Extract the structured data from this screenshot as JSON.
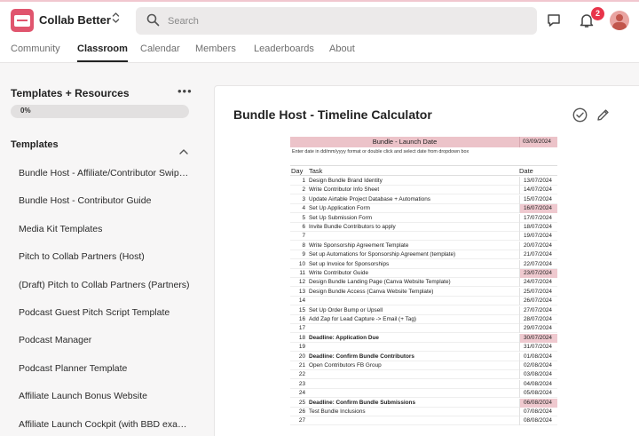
{
  "app": {
    "name": "Collab Better"
  },
  "search": {
    "placeholder": "Search"
  },
  "notifications": {
    "count": "2"
  },
  "nav": {
    "tabs": [
      "Community",
      "Classroom",
      "Calendar",
      "Members",
      "Leaderboards",
      "About"
    ],
    "active": "Classroom"
  },
  "sidebar": {
    "course_title": "Templates + Resources",
    "progress_label": "0%",
    "progress_value": 0,
    "section_title": "Templates",
    "lessons": [
      "Bundle Host - Affiliate/Contributor Swipe Copy",
      "Bundle Host - Contributor Guide",
      "Media Kit Templates",
      "Pitch to Collab Partners (Host)",
      "(Draft) Pitch to Collab Partners (Partners)",
      "Podcast Guest Pitch Script Template",
      "Podcast Manager",
      "Podcast Planner Template",
      "Affiliate Launch Bonus Website",
      "Affiliate Launch Cockpit (with BBD example)"
    ]
  },
  "main": {
    "title": "Bundle Host - Timeline Calculator"
  },
  "sheet": {
    "header": "Bundle - Launch Date",
    "header_date": "03/09/2024",
    "instructions": "Enter date in dd/mm/yyyy format or double click and select date from dropdown box",
    "col_day": "Day",
    "col_task": "Task",
    "col_date": "Date",
    "rows": [
      {
        "day": "1",
        "task": "Design Bundle Brand Identity",
        "date": "13/07/2024"
      },
      {
        "day": "2",
        "task": "Write Contributor Info Sheet",
        "date": "14/07/2024"
      },
      {
        "day": "3",
        "task": "Update Airtable Project Database + Automations",
        "date": "15/07/2024"
      },
      {
        "day": "4",
        "task": "Set Up Application Form",
        "date": "16/07/2024",
        "highlight": true
      },
      {
        "day": "5",
        "task": "Set Up Submission Form",
        "date": "17/07/2024"
      },
      {
        "day": "6",
        "task": "Invite Bundle Contributors to apply",
        "date": "18/07/2024"
      },
      {
        "day": "7",
        "task": "",
        "date": "19/07/2024"
      },
      {
        "day": "8",
        "task": "Write Sponsorship Agreement Template",
        "date": "20/07/2024"
      },
      {
        "day": "9",
        "task": "Set up Automations for Sponsorship Agreement (template)",
        "date": "21/07/2024"
      },
      {
        "day": "10",
        "task": "Set up Invoice for Sponsorships",
        "date": "22/07/2024"
      },
      {
        "day": "11",
        "task": "Write Contributor Guide",
        "date": "23/07/2024",
        "highlight": true
      },
      {
        "day": "12",
        "task": "Design Bundle Landing Page (Canva Website Template)",
        "date": "24/07/2024"
      },
      {
        "day": "13",
        "task": "Design Bundle Access (Canva Website Template)",
        "date": "25/07/2024"
      },
      {
        "day": "14",
        "task": "",
        "date": "26/07/2024"
      },
      {
        "day": "15",
        "task": "Set Up Order Bump or Upsell",
        "date": "27/07/2024"
      },
      {
        "day": "16",
        "task": "Add Zap for Lead Capture -> Email (+ Tag)",
        "date": "28/07/2024"
      },
      {
        "day": "17",
        "task": "",
        "date": "29/07/2024"
      },
      {
        "day": "18",
        "task": "Deadline: Application Due",
        "date": "30/07/2024",
        "highlight": true,
        "bold": true
      },
      {
        "day": "19",
        "task": "",
        "date": "31/07/2024"
      },
      {
        "day": "20",
        "task": "Deadline: Confirm Bundle Contributors",
        "date": "01/08/2024",
        "bold": true
      },
      {
        "day": "21",
        "task": "Open Contributors FB Group",
        "date": "02/08/2024"
      },
      {
        "day": "22",
        "task": "",
        "date": "03/08/2024"
      },
      {
        "day": "23",
        "task": "",
        "date": "04/08/2024"
      },
      {
        "day": "24",
        "task": "",
        "date": "05/08/2024"
      },
      {
        "day": "25",
        "task": "Deadline: Confirm Bundle Submissions",
        "date": "06/08/2024",
        "highlight": true,
        "bold": true
      },
      {
        "day": "26",
        "task": "Test Bundle Inclusions",
        "date": "07/08/2024"
      },
      {
        "day": "27",
        "task": "",
        "date": "08/08/2024"
      }
    ]
  },
  "colors": {
    "accent": "#e0556e",
    "badge": "#e8344a",
    "highlight": "#efc9cf",
    "sheet_header": "#ecc3c9"
  },
  "icons": [
    "app-logo-icon",
    "switcher-chevron-icon",
    "search-icon",
    "chat-icon",
    "bell-icon",
    "more-dots-icon",
    "chevron-up-icon",
    "check-circle-icon",
    "pencil-icon"
  ]
}
